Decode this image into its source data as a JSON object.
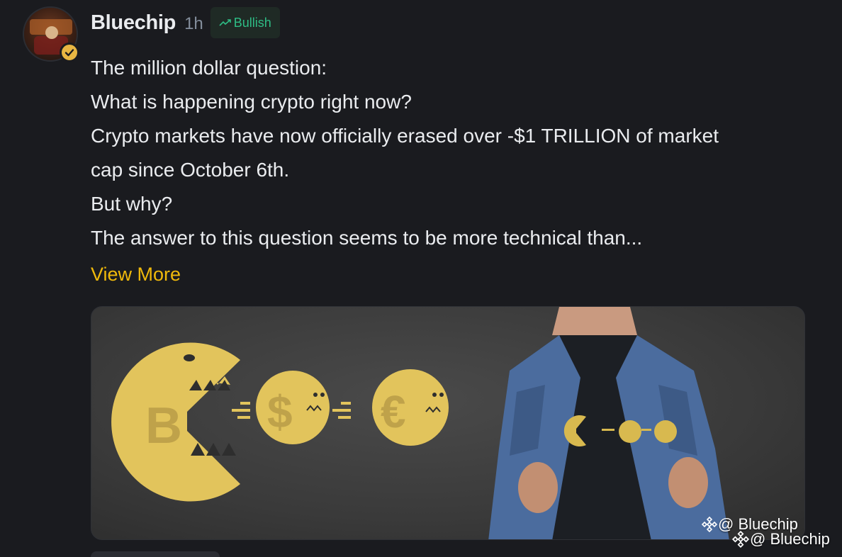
{
  "post": {
    "author": "Bluechip",
    "time": "1h",
    "sentiment": "Bullish",
    "lines": [
      "The million dollar question:",
      "What is happening crypto right now?",
      "Crypto markets have now officially erased over -$1 TRILLION of market",
      "cap since October 6th.",
      "But why?",
      "The answer to this question seems to be more technical than..."
    ],
    "view_more": "View More"
  },
  "image": {
    "watermark_inner": "@ Bluechip",
    "watermark_outer": "@ Bluechip",
    "symbols": [
      "B",
      "$",
      "€"
    ]
  },
  "colors": {
    "accent": "#f0b90b",
    "bullish": "#2ebd85",
    "background": "#1a1b1f",
    "coin_yellow": "#e2c45c"
  }
}
